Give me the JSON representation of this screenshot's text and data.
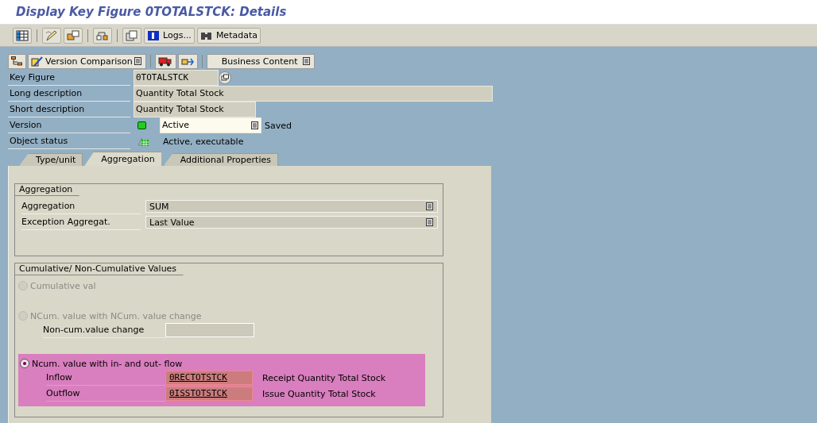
{
  "window": {
    "title": "Display Key Figure 0TOTALSTCK: Details"
  },
  "toolbar": {
    "buttons": [
      {
        "label": "Logs..."
      },
      {
        "label": "Metadata"
      }
    ]
  },
  "app_toolbar": {
    "version_comparison": "Version Comparison",
    "business_content": "Business Content"
  },
  "header": {
    "key_figure": {
      "label": "Key Figure",
      "value": "0TOTALSTCK"
    },
    "long_description": {
      "label": "Long description",
      "value": "Quantity Total Stock"
    },
    "short_description": {
      "label": "Short description",
      "value": "Quantity Total Stock"
    },
    "version": {
      "label": "Version",
      "color": "#22cc22",
      "value": "Active",
      "state": "Saved"
    },
    "object_status": {
      "label": "Object status",
      "value": "Active, executable"
    }
  },
  "tabs": [
    {
      "label": "Type/unit",
      "selected": false
    },
    {
      "label": "Aggregation",
      "selected": true
    },
    {
      "label": "Additional Properties",
      "selected": false
    }
  ],
  "aggregation_group": {
    "title": "Aggregation",
    "fields": [
      {
        "label": "Aggregation",
        "value": "SUM"
      },
      {
        "label": "Exception Aggregat.",
        "value": "Last Value"
      }
    ]
  },
  "cumulative_group": {
    "title": "Cumulative/ Non-Cumulative Values",
    "options": [
      {
        "label": "Cumulative val",
        "selected": false,
        "disabled": true,
        "highlighted": false
      },
      {
        "label": "NCum. value with NCum. value change",
        "selected": false,
        "disabled": true,
        "highlighted": false,
        "fields": [
          {
            "label": "Non-cum.value change"
          }
        ]
      },
      {
        "label": "Ncum. value with in- and out- flow",
        "selected": true,
        "disabled": false,
        "highlighted": true,
        "fields": [
          {
            "label": "Inflow",
            "value": "0RECTOTSTCK",
            "description": "Receipt Quantity Total Stock"
          },
          {
            "label": "Outflow",
            "value": "0ISSTOTSTCK",
            "description": "Issue Quantity Total Stock"
          }
        ]
      }
    ]
  }
}
